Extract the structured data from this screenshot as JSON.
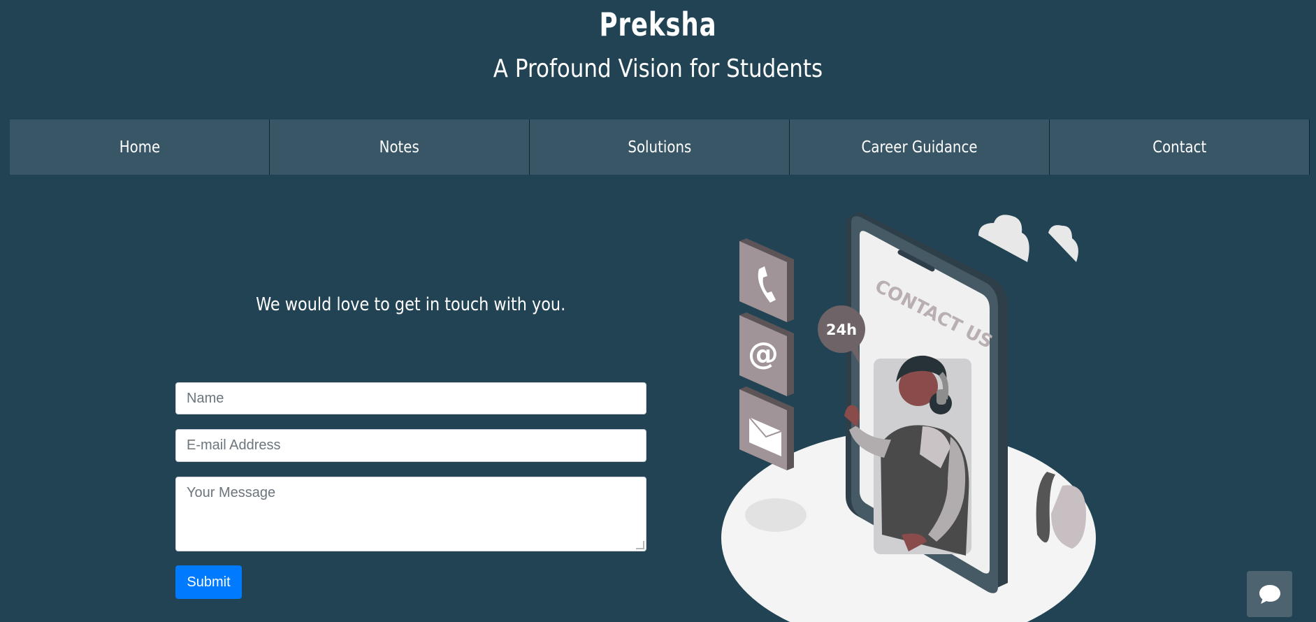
{
  "header": {
    "title": "Preksha",
    "subtitle": "A Profound Vision for Students"
  },
  "nav": {
    "items": [
      {
        "label": "Home"
      },
      {
        "label": "Notes"
      },
      {
        "label": "Solutions"
      },
      {
        "label": "Career Guidance"
      },
      {
        "label": "Contact"
      }
    ]
  },
  "contact": {
    "headline": "We would love to get in touch with you.",
    "name_placeholder": "Name",
    "email_placeholder": "E-mail Address",
    "message_placeholder": "Your Message",
    "submit_label": "Submit"
  },
  "illustration": {
    "phone_text": "CONTACT US",
    "badge_text": "24h"
  },
  "icons": {
    "chat": "chat-bubble-icon",
    "phone": "phone-icon",
    "at": "at-sign-icon",
    "mail": "envelope-icon"
  },
  "colors": {
    "background": "#224354",
    "nav_background": "#395666",
    "submit": "#007bff"
  }
}
